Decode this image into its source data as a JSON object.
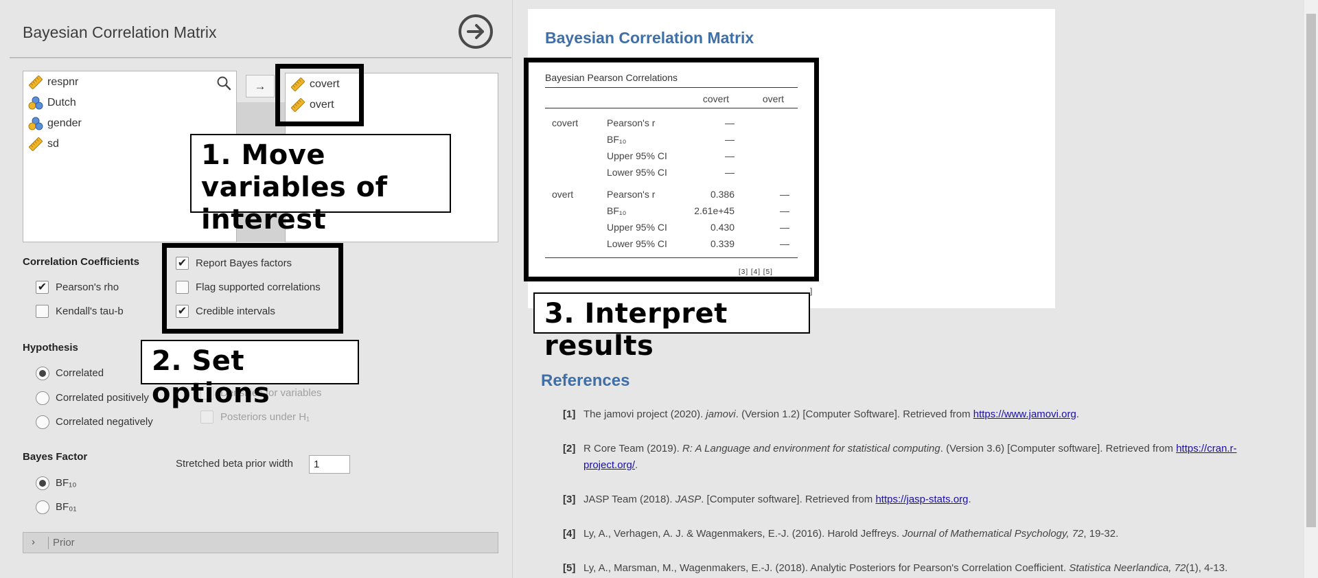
{
  "left_panel": {
    "title": "Bayesian Correlation Matrix",
    "move_arrow": "→",
    "source_variables": [
      {
        "name": "respnr",
        "type": "continuous"
      },
      {
        "name": "Dutch",
        "type": "nominal"
      },
      {
        "name": "gender",
        "type": "nominal"
      },
      {
        "name": "sd",
        "type": "continuous"
      }
    ],
    "target_variables": [
      {
        "name": "covert",
        "type": "continuous"
      },
      {
        "name": "overt",
        "type": "continuous"
      }
    ],
    "correlation_coefficients": {
      "heading": "Correlation Coefficients",
      "pearson": {
        "label": "Pearson's rho",
        "checked": true
      },
      "kendall": {
        "label": "Kendall's tau-b",
        "checked": false
      }
    },
    "additional_options": {
      "report_bf": {
        "label": "Report Bayes factors",
        "checked": true
      },
      "flag_supported": {
        "label": "Flag supported correlations",
        "checked": false
      },
      "credible_intervals": {
        "label": "Credible intervals",
        "checked": true
      }
    },
    "hypothesis": {
      "heading": "Hypothesis",
      "options": [
        "Correlated",
        "Correlated positively",
        "Correlated negatively"
      ],
      "selected": "Correlated"
    },
    "plots": {
      "densities": {
        "label": "Densities for variables",
        "checked": false,
        "enabled": false
      },
      "posteriors": {
        "label": "Posteriors under H₁",
        "checked": false,
        "enabled": false
      }
    },
    "bayes_factor": {
      "heading": "Bayes Factor",
      "options": [
        "BF₁₀",
        "BF₀₁"
      ],
      "selected": "BF₁₀"
    },
    "prior_width": {
      "label": "Stretched beta prior width",
      "value": "1"
    },
    "prior_section": {
      "chevron": "›",
      "label": "Prior"
    }
  },
  "results": {
    "title": "Bayesian Correlation Matrix",
    "table": {
      "title": "Bayesian Pearson Correlations",
      "columns": [
        "covert",
        "overt"
      ],
      "rows": [
        {
          "var": "covert",
          "stats": [
            {
              "label": "Pearson's r",
              "values": [
                "—",
                ""
              ]
            },
            {
              "label": "BF₁₀",
              "values": [
                "—",
                ""
              ]
            },
            {
              "label": "Upper 95% CI",
              "values": [
                "—",
                ""
              ]
            },
            {
              "label": "Lower 95% CI",
              "values": [
                "—",
                ""
              ]
            }
          ]
        },
        {
          "var": "overt",
          "stats": [
            {
              "label": "Pearson's r",
              "values": [
                "0.386",
                "—"
              ]
            },
            {
              "label": "BF₁₀",
              "values": [
                "2.61e+45",
                "—"
              ]
            },
            {
              "label": "Upper 95% CI",
              "values": [
                "0.430",
                "—"
              ]
            },
            {
              "label": "Lower 95% CI",
              "values": [
                "0.339",
                "—"
              ]
            }
          ]
        }
      ],
      "footnote_refs": "[3] [4] [5]"
    },
    "stray_bracket": "]"
  },
  "references": {
    "heading": "References",
    "items": [
      {
        "num": "[1]",
        "pre": "The jamovi project (2020). ",
        "em": "jamovi",
        "post": ". (Version 1.2) [Computer Software]. Retrieved from ",
        "link": "https://www.jamovi.org",
        "tail": "."
      },
      {
        "num": "[2]",
        "pre": "R Core Team (2019). ",
        "em": "R: A Language and environment for statistical computing",
        "post": ". (Version 3.6) [Computer software]. Retrieved from ",
        "link": "https://cran.r-project.org/",
        "tail": "."
      },
      {
        "num": "[3]",
        "pre": "JASP Team (2018). ",
        "em": "JASP",
        "post": ". [Computer software]. Retrieved from ",
        "link": "https://jasp-stats.org",
        "tail": "."
      },
      {
        "num": "[4]",
        "pre": "Ly, A., Verhagen, A. J. & Wagenmakers, E.-J. (2016). Harold Jeffreys. ",
        "em": "Journal of Mathematical Psychology, 72",
        "post": ", 19-32.",
        "link": "",
        "tail": ""
      },
      {
        "num": "[5]",
        "pre": "Ly, A., Marsman, M., Wagenmakers, E.-J. (2018). Analytic Posteriors for Pearson's Correlation Coefficient. ",
        "em": "Statistica Neerlandica, 72",
        "post": "(1), 4-13.",
        "link": "",
        "tail": ""
      }
    ]
  },
  "annotations": {
    "step1": "1. Move variables of interest",
    "step2": "2. Set options",
    "step3": "3. Interpret results"
  },
  "colors": {
    "accent_blue": "#3e6fa8",
    "link": "#1a0dab",
    "continuous_icon": "#f0b429",
    "nominal_icon_blue": "#5b8fd6",
    "nominal_icon_orange": "#f0b429"
  }
}
